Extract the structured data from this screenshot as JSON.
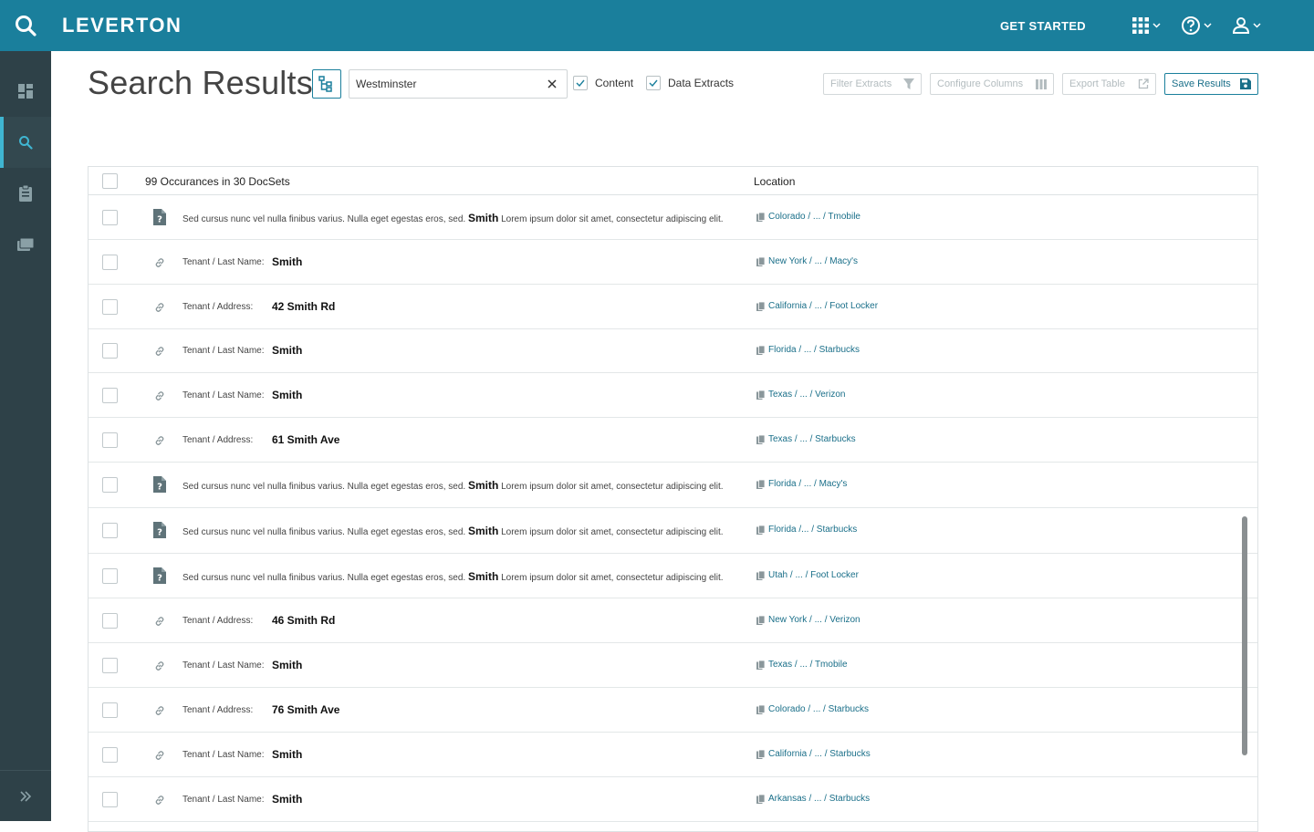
{
  "app": {
    "brand": "LEVERTON",
    "get_started": "GET STARTED"
  },
  "header": {
    "title": "Search Results:",
    "search_value": "Westminster",
    "checkbox_content": "Content",
    "checkbox_extracts": "Data Extracts",
    "filter_extracts": "Filter Extracts",
    "configure_columns": "Configure Columns",
    "export_table": "Export Table",
    "save_results": "Save Results"
  },
  "table": {
    "count_header": "99 Occurances in 30 DocSets",
    "location_header": "Location",
    "rows": [
      {
        "type": "content",
        "pre": "Sed cursus nunc vel nulla finibus varius. Nulla eget egestas eros, sed.",
        "hit": "Smith",
        "post": "Lorem ipsum dolor sit amet, consectetur adipiscing elit.",
        "location": "Colorado / ... / Tmobile"
      },
      {
        "type": "extract",
        "label": "Tenant / Last Name:",
        "value": "Smith",
        "location": "New York / ... / Macy's"
      },
      {
        "type": "extract",
        "label": "Tenant / Address:",
        "value": "42 Smith Rd",
        "location": "California / ... / Foot Locker"
      },
      {
        "type": "extract",
        "label": "Tenant / Last Name:",
        "value": "Smith",
        "location": "Florida / ... / Starbucks"
      },
      {
        "type": "extract",
        "label": "Tenant / Last Name:",
        "value": "Smith",
        "location": "Texas / ... / Verizon"
      },
      {
        "type": "extract",
        "label": "Tenant / Address:",
        "value": "61 Smith Ave",
        "location": "Texas / ... / Starbucks"
      },
      {
        "type": "content",
        "pre": "Sed cursus nunc vel nulla finibus varius. Nulla eget egestas eros, sed.",
        "hit": "Smith",
        "post": "Lorem ipsum dolor sit amet, consectetur adipiscing elit.",
        "location": "Florida / ... / Macy's"
      },
      {
        "type": "content",
        "pre": "Sed cursus nunc vel nulla finibus varius. Nulla eget egestas eros, sed.",
        "hit": "Smith",
        "post": "Lorem ipsum dolor sit amet, consectetur adipiscing elit.",
        "location": "Florida /... / Starbucks"
      },
      {
        "type": "content",
        "pre": "Sed cursus nunc vel nulla finibus varius. Nulla eget egestas eros, sed.",
        "hit": "Smith",
        "post": "Lorem ipsum dolor sit amet, consectetur adipiscing elit.",
        "location": "Utah / ... / Foot Locker"
      },
      {
        "type": "extract",
        "label": "Tenant / Address:",
        "value": "46 Smith Rd",
        "location": "New York / ... / Verizon"
      },
      {
        "type": "extract",
        "label": "Tenant / Last Name:",
        "value": "Smith",
        "location": "Texas / ... / Tmobile"
      },
      {
        "type": "extract",
        "label": "Tenant / Address:",
        "value": "76 Smith Ave",
        "location": "Colorado / ... / Starbucks"
      },
      {
        "type": "extract",
        "label": "Tenant / Last Name:",
        "value": "Smith",
        "location": "California / ... / Starbucks"
      },
      {
        "type": "extract",
        "label": "Tenant / Last Name:",
        "value": "Smith",
        "location": "Arkansas / ... / Starbucks"
      }
    ]
  },
  "colors": {
    "topbar": "#1a7f9c",
    "sidebar": "#2e4148",
    "accent": "#3fb5d1",
    "link": "#1a6f89"
  }
}
